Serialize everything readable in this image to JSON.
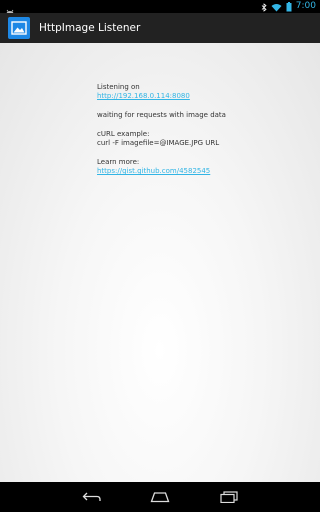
{
  "status_bar": {
    "time": "7:00",
    "icons": [
      "android-notification-icon",
      "bluetooth-icon",
      "wifi-icon",
      "battery-icon"
    ]
  },
  "action_bar": {
    "title": "HttpImage Listener",
    "icon": "image-icon",
    "icon_color": "#1e88e5"
  },
  "content": {
    "listening_label": "Listening on",
    "listening_url": "http://192.168.0.114:8080",
    "waiting_text": "waiting for requests with image data",
    "curl_label": "cURL example:",
    "curl_command": "curl -F imagefile=@IMAGE.JPG URL",
    "learn_more_label": "Learn more:",
    "learn_more_url": "https://gist.github.com/4582545",
    "link_color": "#33b5e5"
  },
  "nav_bar": {
    "buttons": [
      "back-icon",
      "home-icon",
      "recent-apps-icon"
    ]
  }
}
